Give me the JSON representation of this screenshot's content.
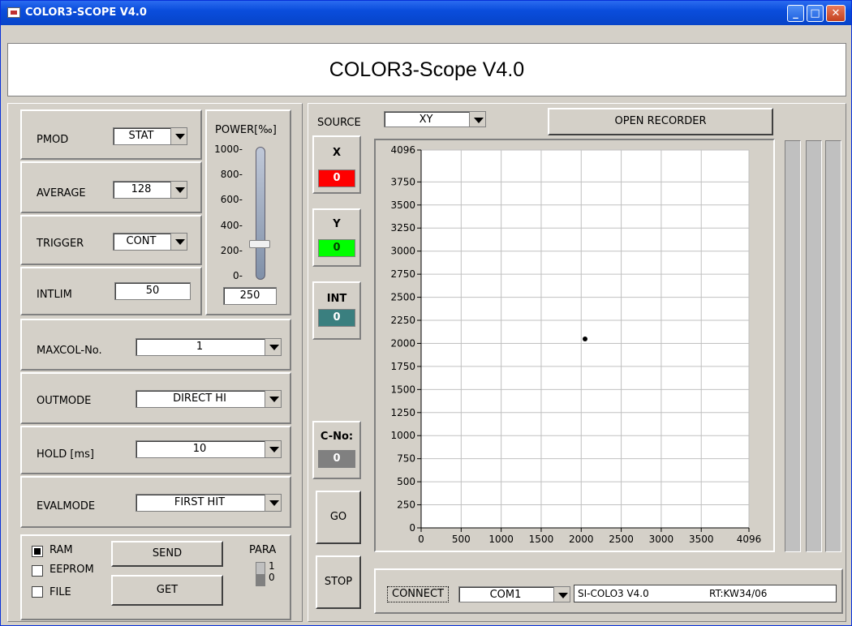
{
  "window": {
    "title": "COLOR3-SCOPE V4.0",
    "minimize": "_",
    "maximize": "□",
    "close": "✕"
  },
  "header": {
    "title": "COLOR3-Scope V4.0"
  },
  "params": {
    "pmod": {
      "label": "PMOD",
      "value": "STAT"
    },
    "average": {
      "label": "AVERAGE",
      "value": "128"
    },
    "trigger": {
      "label": "TRIGGER",
      "value": "CONT"
    },
    "intlim": {
      "label": "INTLIM",
      "value": "50"
    },
    "maxcol": {
      "label": "MAXCOL-No.",
      "value": "1"
    },
    "outmode": {
      "label": "OUTMODE",
      "value": "DIRECT HI"
    },
    "hold": {
      "label": "HOLD [ms]",
      "value": "10"
    },
    "evalmode": {
      "label": "EVALMODE",
      "value": "FIRST HIT"
    }
  },
  "power": {
    "label": "POWER[‰]",
    "ticks": [
      "1000",
      "800",
      "600",
      "400",
      "200",
      "0"
    ],
    "value": "250",
    "level": 250,
    "max": 1000
  },
  "memory": {
    "ram": "RAM",
    "eeprom": "EEPROM",
    "file": "FILE",
    "send": "SEND",
    "get": "GET",
    "para_label": "PARA",
    "para_1": "1",
    "para_0": "0",
    "selected": "RAM"
  },
  "source": {
    "label": "SOURCE",
    "value": "XY"
  },
  "recorder_button": "OPEN RECORDER",
  "readouts": {
    "x": {
      "label": "X",
      "value": "0",
      "color": "#ff0000"
    },
    "y": {
      "label": "Y",
      "value": "0",
      "color": "#00ff00"
    },
    "int": {
      "label": "INT",
      "value": "0",
      "color": "#3a7f7f"
    },
    "cno": {
      "label": "C-No:",
      "value": "0",
      "color": "#808080"
    }
  },
  "go_button": "GO",
  "stop_button": "STOP",
  "chart_data": {
    "type": "scatter",
    "x": [
      2048
    ],
    "y": [
      2048
    ],
    "xlim": [
      0,
      4096
    ],
    "ylim": [
      0,
      4096
    ],
    "x_ticks": [
      "0",
      "500",
      "1000",
      "1500",
      "2000",
      "2500",
      "3000",
      "3500",
      "4096"
    ],
    "y_ticks": [
      "4096",
      "3750",
      "3500",
      "3250",
      "3000",
      "2750",
      "2500",
      "2250",
      "2000",
      "1750",
      "1500",
      "1250",
      "1000",
      "750",
      "500",
      "250",
      "0"
    ],
    "grid": true,
    "xlabel": "",
    "ylabel": "",
    "title": ""
  },
  "connect": {
    "label": "CONNECT",
    "port": "COM1",
    "status": "SI-COLO3 V4.0",
    "rt": "RT:KW34/06"
  }
}
